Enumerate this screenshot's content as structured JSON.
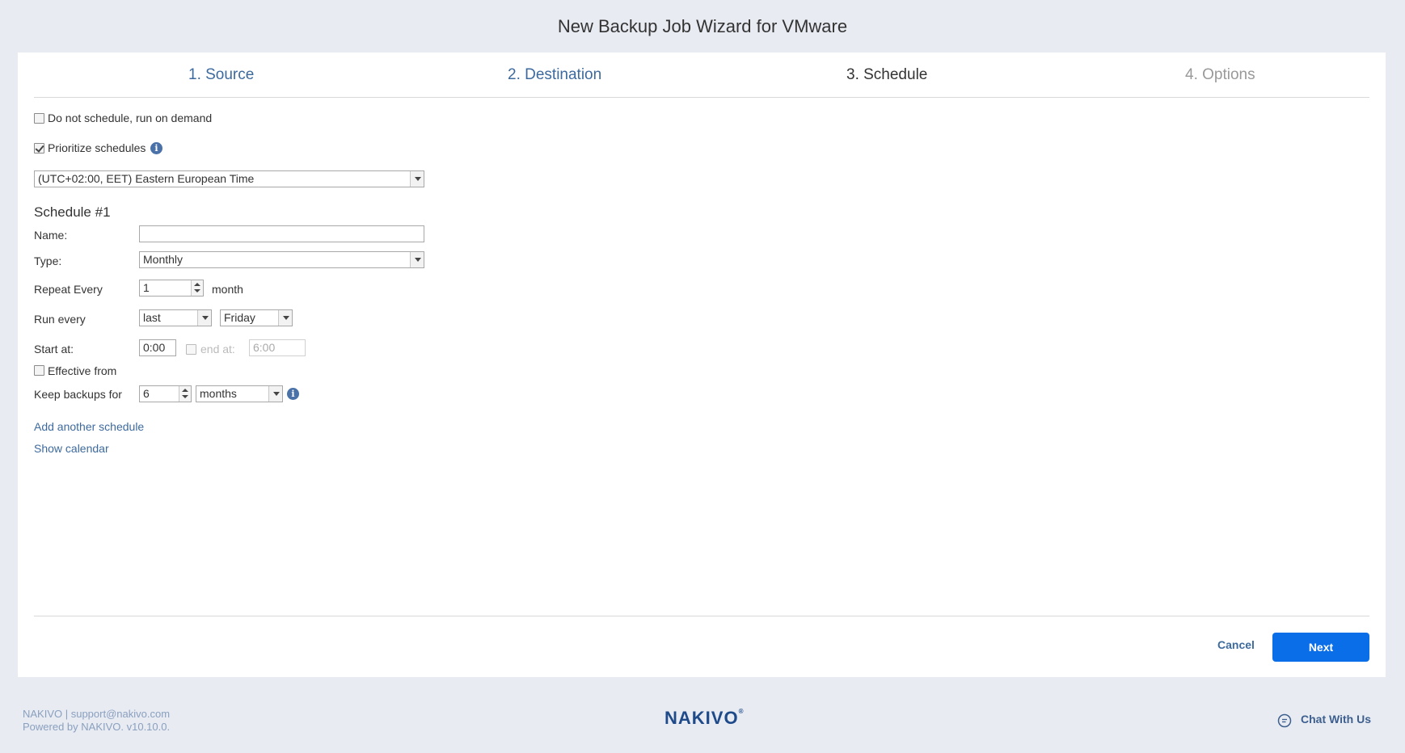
{
  "window": {
    "title": "New Backup Job Wizard for VMware"
  },
  "steps": [
    {
      "label": "1. Source",
      "state": "done"
    },
    {
      "label": "2. Destination",
      "state": "done"
    },
    {
      "label": "3. Schedule",
      "state": "active"
    },
    {
      "label": "4. Options",
      "state": "pending"
    }
  ],
  "options": {
    "no_schedule_label": "Do not schedule, run on demand",
    "no_schedule_checked": false,
    "prioritize_label": "Prioritize schedules",
    "prioritize_checked": true
  },
  "timezone": {
    "value": "(UTC+02:00, EET) Eastern European Time"
  },
  "schedule": {
    "title": "Schedule #1",
    "name_label": "Name:",
    "name_value": "",
    "type_label": "Type:",
    "type_value": "Monthly",
    "repeat_label": "Repeat Every",
    "repeat_value": "1",
    "repeat_unit": "month",
    "run_every_label": "Run every",
    "run_every_ordinal": "last",
    "run_every_day": "Friday",
    "start_label": "Start at:",
    "start_value": "0:00",
    "end_label": "end at:",
    "end_checked": false,
    "end_value": "6:00",
    "effective_label": "Effective from",
    "effective_checked": false,
    "keep_label": "Keep backups for",
    "keep_value": "6",
    "keep_unit": "months"
  },
  "links": {
    "add_schedule": "Add another schedule",
    "show_calendar": "Show calendar"
  },
  "buttons": {
    "cancel": "Cancel",
    "next": "Next"
  },
  "footer": {
    "line1": "NAKIVO | support@nakivo.com",
    "line2": "Powered by NAKIVO. v10.10.0.",
    "logo": "NAKIVO",
    "chat": "Chat With Us"
  },
  "colors": {
    "accent": "#0a6ee8",
    "link": "#3d6a9e",
    "background": "#e8ebf2"
  }
}
